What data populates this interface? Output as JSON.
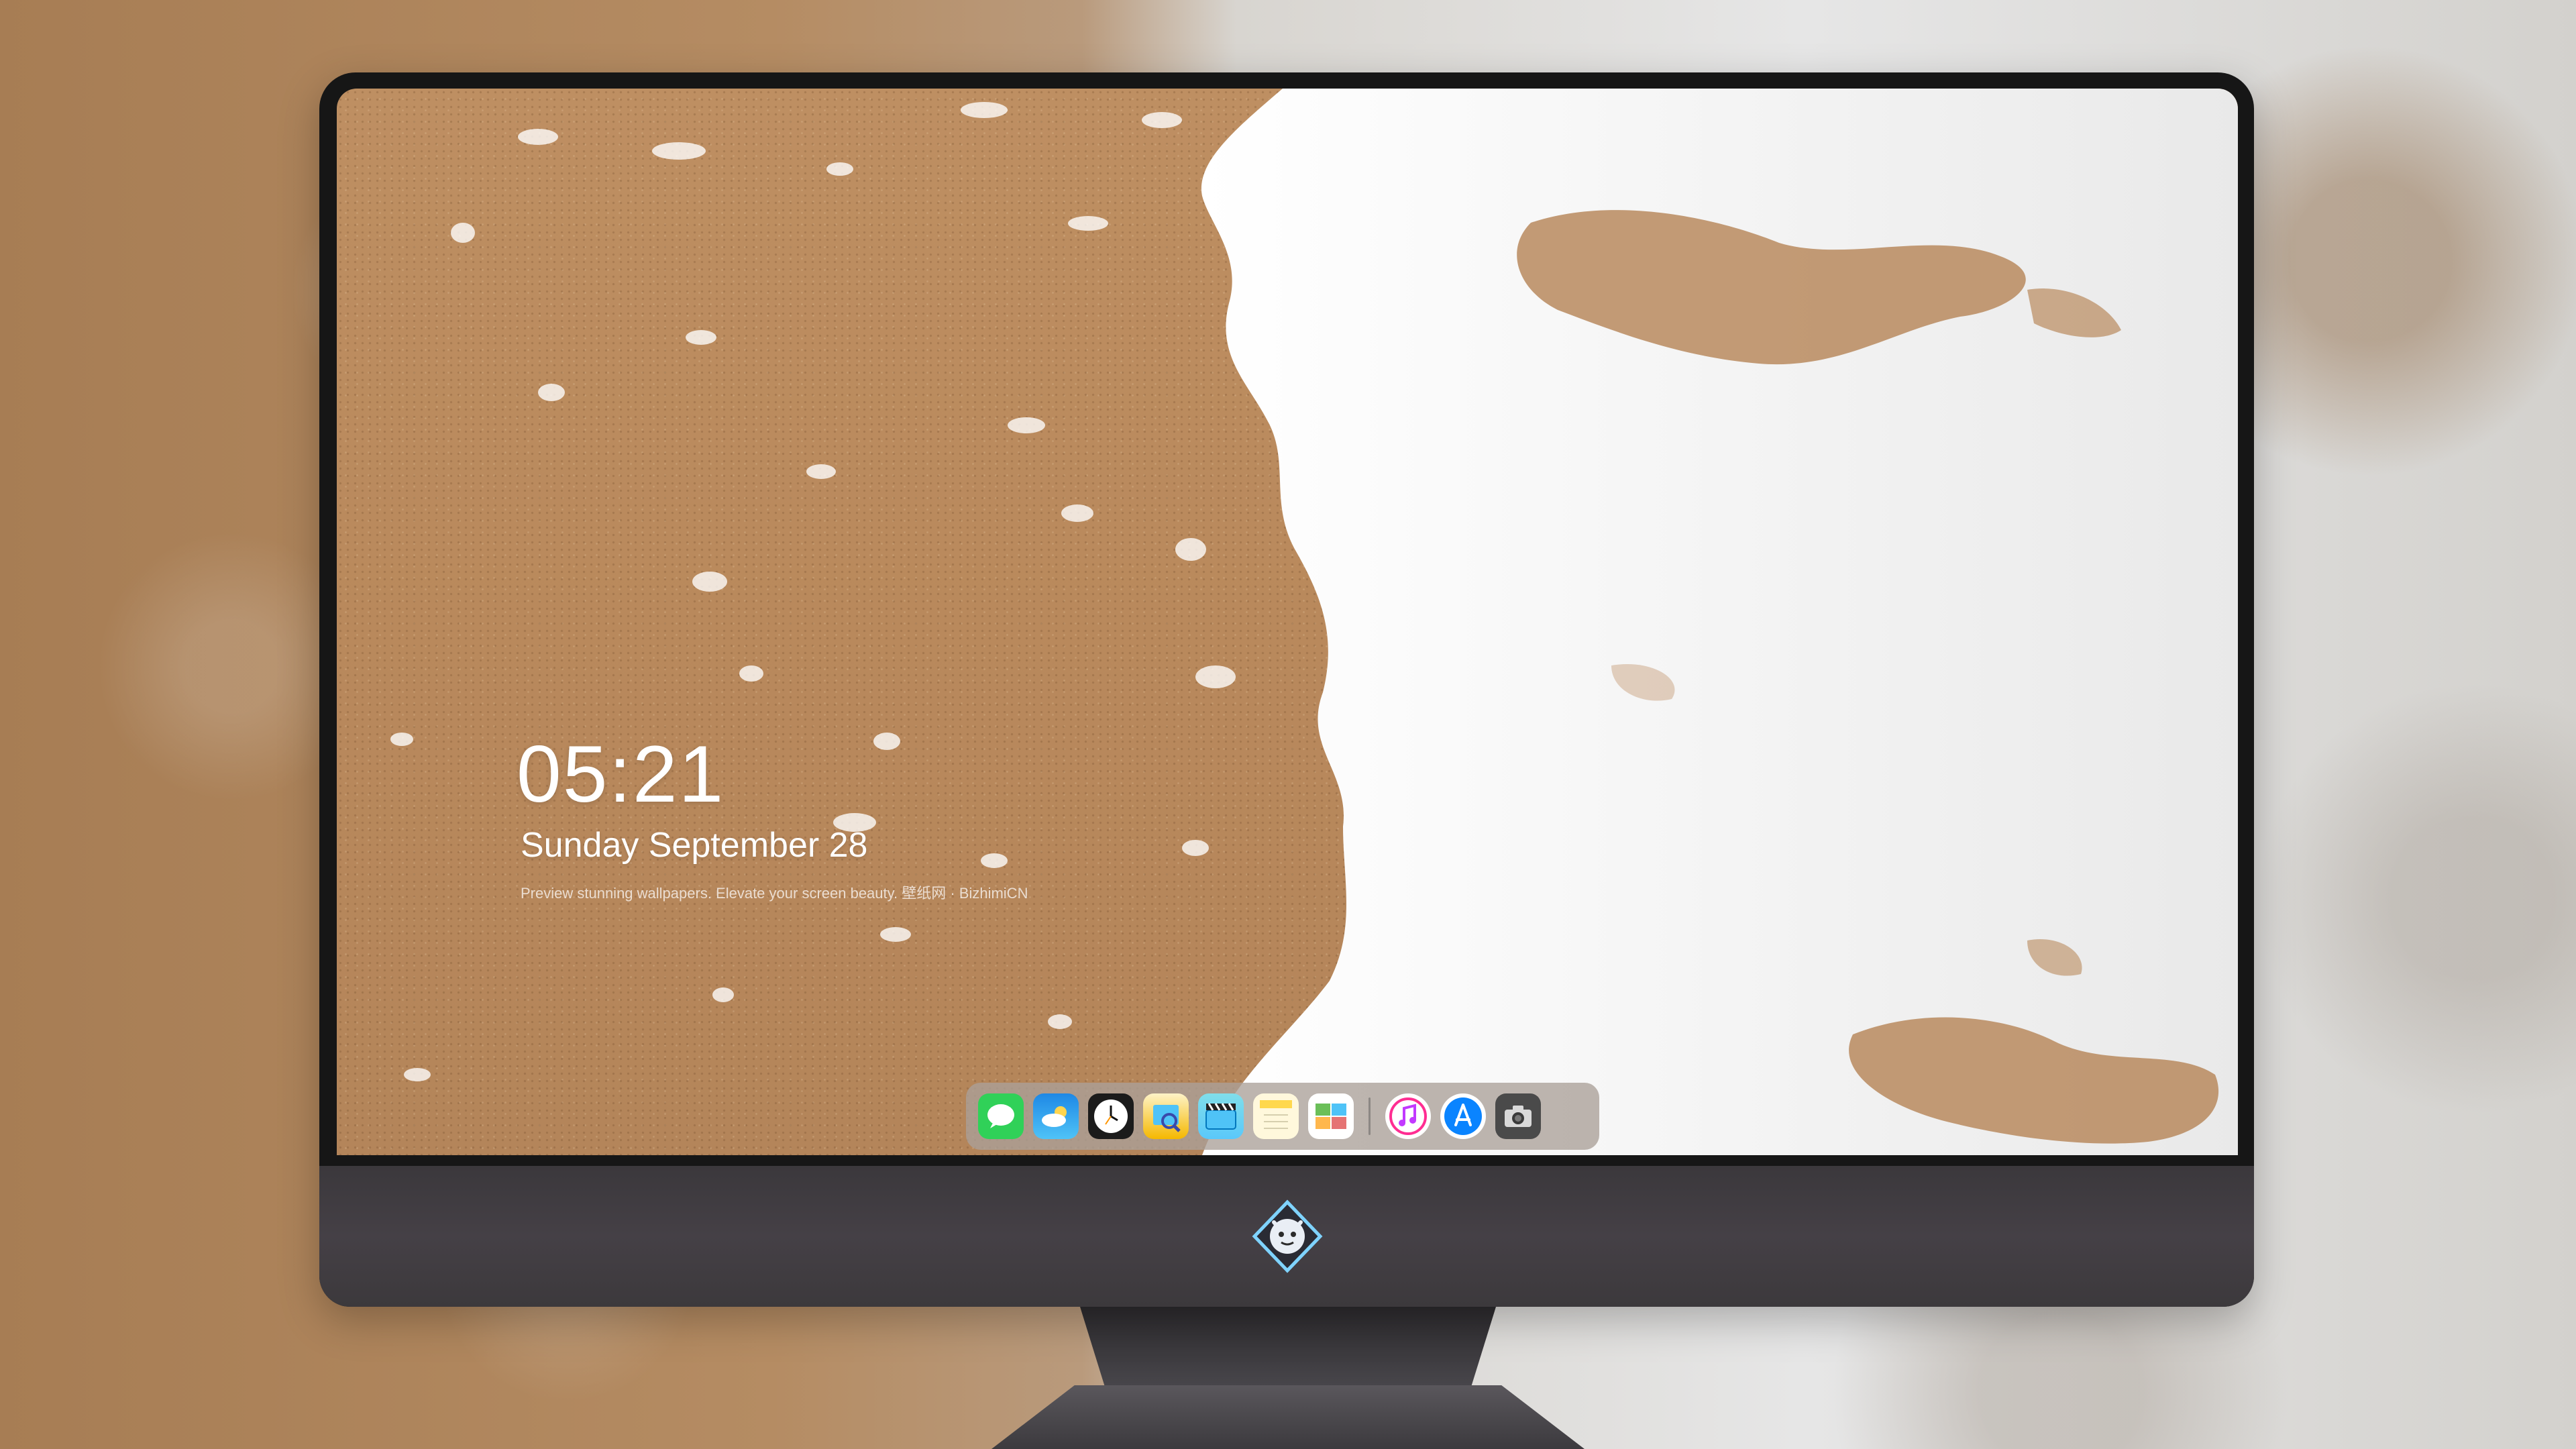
{
  "lockscreen": {
    "time": "05:21",
    "date": "Sunday September  28",
    "tagline": "Preview stunning wallpapers. Elevate your screen beauty. 壁纸网 · BizhimiCN"
  },
  "dock": {
    "apps": [
      {
        "name": "messages-icon",
        "color": "#30d158"
      },
      {
        "name": "weather-icon",
        "color": "#1e88e5"
      },
      {
        "name": "clock-icon",
        "color": "#1b1b1b"
      },
      {
        "name": "preview-icon",
        "color": "#f5b800"
      },
      {
        "name": "video-icon",
        "color": "#5ac8fa"
      },
      {
        "name": "notes-icon",
        "color": "#ffd84d"
      },
      {
        "name": "photo-icon",
        "color": "#6bbf59"
      },
      {
        "name": "music-icon",
        "color": "#ff2d92"
      },
      {
        "name": "app-store-icon",
        "color": "#0a84ff"
      },
      {
        "name": "camera-icon",
        "color": "#4a4a4a"
      }
    ]
  },
  "colors": {
    "sand": "#b9895c",
    "foam": "#f4f4f4",
    "bezel": "#161616",
    "chin": "#413e43"
  }
}
